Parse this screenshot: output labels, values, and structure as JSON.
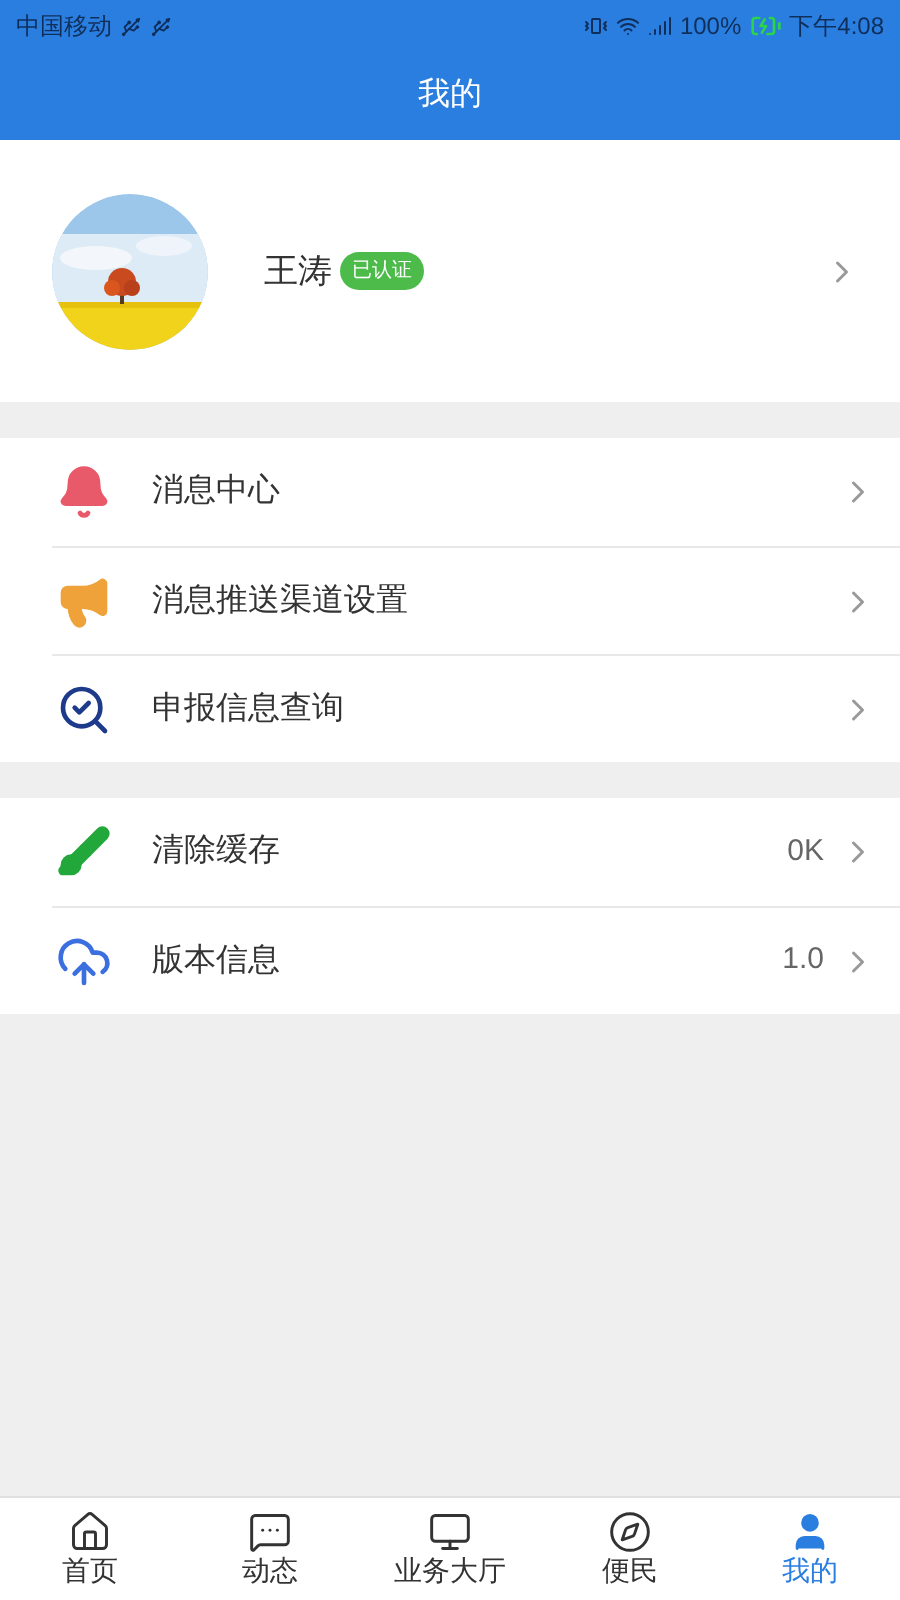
{
  "status_bar": {
    "carrier": "中国移动",
    "battery": "100%",
    "time": "下午4:08"
  },
  "header": {
    "title": "我的"
  },
  "profile": {
    "name": "王涛",
    "badge": "已认证"
  },
  "groups": [
    {
      "items": [
        {
          "label": "消息中心"
        },
        {
          "label": "消息推送渠道设置"
        },
        {
          "label": "申报信息查询"
        }
      ]
    },
    {
      "items": [
        {
          "label": "清除缓存",
          "value": "0K"
        },
        {
          "label": "版本信息",
          "value": "1.0"
        }
      ]
    }
  ],
  "tabs": [
    {
      "label": "首页",
      "selected": false
    },
    {
      "label": "动态",
      "selected": false
    },
    {
      "label": "业务大厅",
      "selected": false
    },
    {
      "label": "便民",
      "selected": false
    },
    {
      "label": "我的",
      "selected": true
    }
  ]
}
